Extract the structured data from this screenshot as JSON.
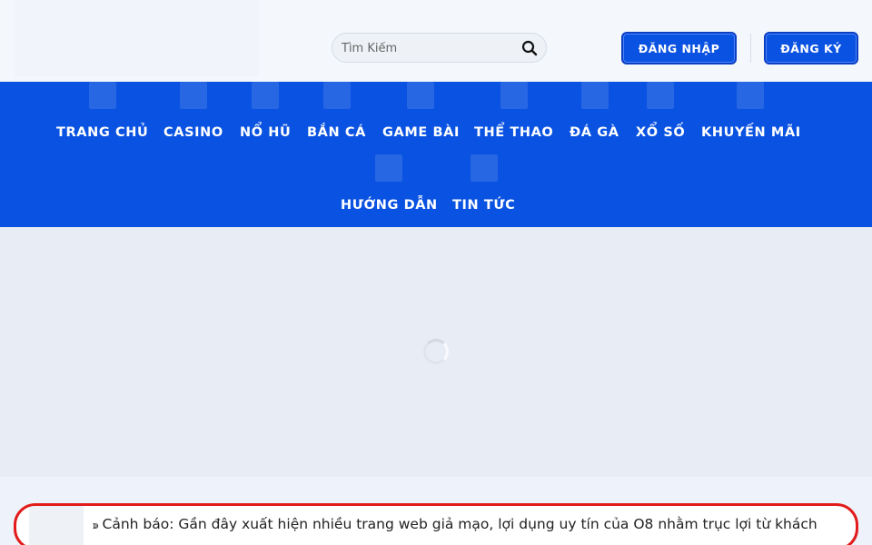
{
  "header": {
    "search": {
      "placeholder": "Tìm Kiếm"
    },
    "login_label": "ĐĂNG NHẬP",
    "register_label": "ĐĂNG KÝ"
  },
  "nav": {
    "items": [
      {
        "label": "TRANG CHỦ",
        "icon": "home-icon"
      },
      {
        "label": "CASINO",
        "icon": "casino-icon"
      },
      {
        "label": "NỔ HŨ",
        "icon": "slot-icon"
      },
      {
        "label": "BẮN CÁ",
        "icon": "fish-icon"
      },
      {
        "label": "GAME BÀI",
        "icon": "cards-icon"
      },
      {
        "label": "THỂ THAO",
        "icon": "sports-icon"
      },
      {
        "label": "ĐÁ GÀ",
        "icon": "rooster-icon"
      },
      {
        "label": "XỔ SỐ",
        "icon": "lottery-icon"
      },
      {
        "label": "KHUYẾN MÃI",
        "icon": "promo-icon"
      },
      {
        "label": "HƯỚNG DẪN",
        "icon": "guide-icon"
      },
      {
        "label": "TIN TỨC",
        "icon": "news-icon"
      }
    ]
  },
  "ticker": {
    "prefix": "ↇ",
    "text": "Cảnh báo: Gần đây xuất hiện nhiều trang web giả mạo, lợi dụng uy tín của O8 nhằm trục lợi từ khách"
  },
  "colors": {
    "brand_blue": "#0a52e1",
    "ticker_border": "#e21b1b"
  }
}
